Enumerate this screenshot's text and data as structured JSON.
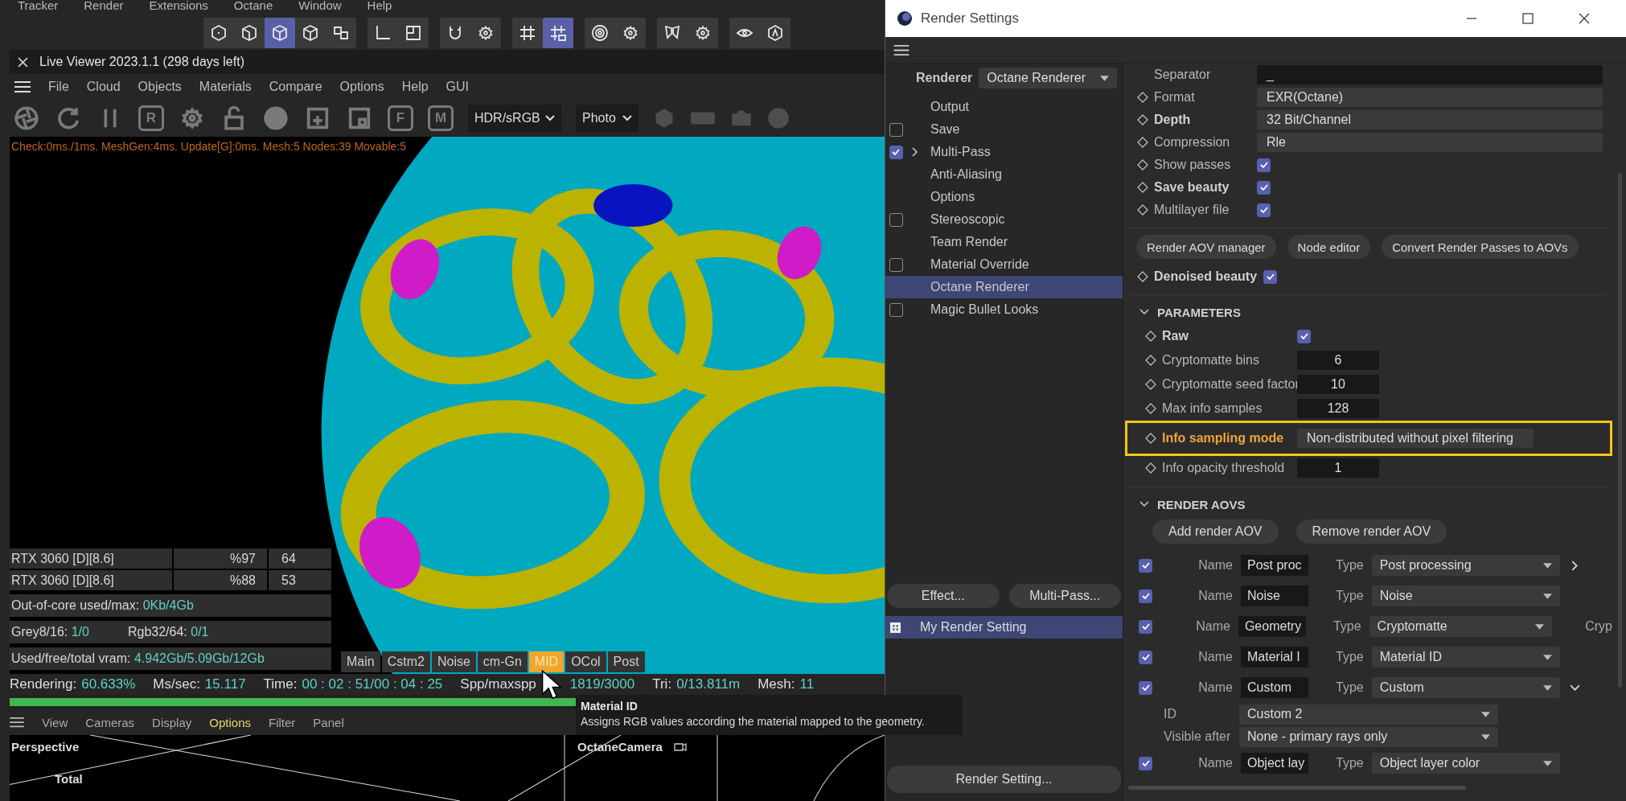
{
  "app_menu": [
    "Tracker",
    "Render",
    "Extensions",
    "Octane",
    "Window",
    "Help"
  ],
  "main_toolbar": [
    [
      {
        "selected": false
      },
      {
        "selected": false
      },
      {
        "selected": true
      },
      {
        "selected": false
      },
      {
        "selected": false
      }
    ],
    [
      {
        "selected": false
      },
      {
        "selected": false
      }
    ],
    [
      {
        "selected": false
      },
      {
        "selected": false
      }
    ],
    [
      {
        "selected": false
      },
      {
        "selected": true
      }
    ],
    [
      {
        "selected": false
      },
      {
        "selected": false
      }
    ],
    [
      {
        "selected": false
      },
      {
        "selected": false
      }
    ],
    [
      {
        "selected": false
      },
      {
        "selected": false
      }
    ]
  ],
  "live_viewer": {
    "title": "Live Viewer 2023.1.1 (298 days left)",
    "menu": [
      "File",
      "Cloud",
      "Objects",
      "Materials",
      "Compare",
      "Options",
      "Help",
      "GUI"
    ],
    "tool_letters": [
      "R",
      "F",
      "M"
    ],
    "display_mode": "HDR/sRGB",
    "camera_mode": "Photo",
    "status_line": "Check:0ms./1ms. MeshGen:4ms. Update[G]:0ms. Mesh:5 Nodes:39 Movable:5",
    "gpus": [
      {
        "name": "RTX 3060 [D][8.6]",
        "usage": "%97",
        "temp": "64"
      },
      {
        "name": "RTX 3060 [D][8.6]",
        "usage": "%88",
        "temp": "53"
      }
    ],
    "memory": [
      [
        {
          "label": "Out-of-core used/max:",
          "value": "0Kb/4Gb"
        }
      ],
      [
        {
          "label": "Grey8/16:",
          "value": "1/0"
        },
        {
          "label": "Rgb32/64:",
          "value": "0/1"
        }
      ],
      [
        {
          "label": "Used/free/total vram:",
          "value": "4.942Gb/5.09Gb/12Gb"
        }
      ]
    ],
    "pass_tabs": [
      {
        "label": "Main",
        "selected": false
      },
      {
        "label": "Cstm2",
        "selected": false
      },
      {
        "label": "Noise",
        "selected": false
      },
      {
        "label": "cm-Gn",
        "selected": false
      },
      {
        "label": "MID",
        "selected": true
      },
      {
        "label": "OCol",
        "selected": false
      },
      {
        "label": "Post",
        "selected": false
      }
    ],
    "render_stats": [
      {
        "label": "Rendering:",
        "value": "60.633%"
      },
      {
        "label": "Ms/sec:",
        "value": "15.117"
      },
      {
        "label": "Time:",
        "value": "00 : 02 : 51/00 : 04 : 25"
      },
      {
        "label": "Spp/maxspp",
        "value": "1819/3000"
      },
      {
        "label": "Tri:",
        "value": "0/13.811m"
      },
      {
        "label": "Mesh:",
        "value": "11"
      }
    ],
    "progress": {
      "level": 0.65
    },
    "tooltip": {
      "title": "Material ID",
      "text": "Assigns RGB values according the material mapped to the geometry."
    }
  },
  "viewport": {
    "menu": [
      {
        "label": "View",
        "selected": false
      },
      {
        "label": "Cameras",
        "selected": false
      },
      {
        "label": "Display",
        "selected": false
      },
      {
        "label": "Options",
        "selected": true
      },
      {
        "label": "Filter",
        "selected": false
      },
      {
        "label": "Panel",
        "selected": false
      }
    ],
    "view_name": "Perspective",
    "overlay_label": "Total",
    "camera_name": "OctaneCamera"
  },
  "render_settings": {
    "title": "Render Settings",
    "renderer_label": "Renderer",
    "renderer": "Octane Renderer",
    "nav": [
      {
        "label": "Output",
        "kind": "plain",
        "expandable": false,
        "selected": false
      },
      {
        "label": "Save",
        "kind": "checkbox",
        "checked": false,
        "expandable": false,
        "selected": false
      },
      {
        "label": "Multi-Pass",
        "kind": "checkbox",
        "checked": true,
        "expandable": true,
        "selected": false
      },
      {
        "label": "Anti-Aliasing",
        "kind": "plain",
        "expandable": false,
        "selected": false
      },
      {
        "label": "Options",
        "kind": "plain",
        "expandable": false,
        "selected": false
      },
      {
        "label": "Stereoscopic",
        "kind": "checkbox",
        "checked": false,
        "expandable": false,
        "selected": false
      },
      {
        "label": "Team Render",
        "kind": "plain",
        "expandable": false,
        "selected": false
      },
      {
        "label": "Material Override",
        "kind": "checkbox",
        "checked": false,
        "expandable": false,
        "selected": false
      },
      {
        "label": "Octane Renderer",
        "kind": "plain",
        "expandable": false,
        "selected": true
      },
      {
        "label": "Magic Bullet Looks",
        "kind": "checkbox",
        "checked": false,
        "expandable": false,
        "selected": false
      }
    ],
    "nav_buttons": [
      "Effect...",
      "Multi-Pass..."
    ],
    "presets": [
      {
        "label": "My Render Setting",
        "selected": true
      }
    ],
    "bottom_button": "Render Setting...",
    "output_props": [
      {
        "label": "Separator",
        "kind": "text",
        "value": "_",
        "bold": false,
        "animatable": false
      },
      {
        "label": "Format",
        "kind": "dropdown",
        "value": "EXR(Octane)",
        "bold": false,
        "animatable": true
      },
      {
        "label": "Depth",
        "kind": "dropdown",
        "value": "32 Bit/Channel",
        "bold": true,
        "animatable": true
      },
      {
        "label": "Compression",
        "kind": "dropdown",
        "value": "Rle",
        "bold": false,
        "animatable": true
      },
      {
        "label": "Show passes",
        "kind": "checkbox",
        "checked": true,
        "bold": false,
        "animatable": true
      },
      {
        "label": "Save beauty",
        "kind": "checkbox",
        "checked": true,
        "bold": true,
        "animatable": true
      },
      {
        "label": "Multilayer file",
        "kind": "checkbox",
        "checked": true,
        "bold": false,
        "animatable": true
      }
    ],
    "action_buttons": [
      "Render AOV manager",
      "Node editor",
      "Convert Render Passes to AOVs"
    ],
    "denoised": {
      "label": "Denoised beauty",
      "checked": true
    },
    "parameters": {
      "title": "PARAMETERS",
      "expanded": true,
      "props": [
        {
          "label": "Raw",
          "kind": "checkbox",
          "checked": true,
          "bold": true,
          "highlighted": false
        },
        {
          "label": "Cryptomatte bins",
          "kind": "number",
          "value": "6",
          "bold": false,
          "highlighted": false
        },
        {
          "label": "Cryptomatte seed factor",
          "kind": "number",
          "value": "10",
          "bold": false,
          "highlighted": false
        },
        {
          "label": "Max info samples",
          "kind": "number",
          "value": "128",
          "bold": false,
          "highlighted": false
        },
        {
          "label": "Info sampling mode",
          "kind": "dropdown",
          "value": "Non-distributed without pixel filtering",
          "bold": true,
          "highlighted": true
        },
        {
          "label": "Info opacity threshold",
          "kind": "number",
          "value": "1",
          "bold": false,
          "highlighted": false
        }
      ]
    },
    "aovs": {
      "title": "RENDER AOVS",
      "expanded": true,
      "buttons": [
        "Add render AOV",
        "Remove render AOV"
      ],
      "rows": [
        {
          "checked": true,
          "name_label": "Name",
          "name": "Post proc",
          "type_label": "Type",
          "type": "Post processing",
          "expanded": false
        },
        {
          "checked": true,
          "name_label": "Name",
          "name": "Noise",
          "type_label": "Type",
          "type": "Noise"
        },
        {
          "checked": true,
          "name_label": "Name",
          "name": "Geometry",
          "type_label": "Type",
          "type": "Cryptomatte",
          "side_text": "Cryp"
        },
        {
          "checked": true,
          "name_label": "Name",
          "name": "Material I",
          "type_label": "Type",
          "type": "Material ID"
        },
        {
          "checked": true,
          "name_label": "Name",
          "name": "Custom",
          "type_label": "Type",
          "type": "Custom",
          "expanded": true,
          "sub": [
            {
              "label": "ID",
              "value": "Custom 2"
            },
            {
              "label": "Visible after",
              "value": "None - primary rays only"
            }
          ]
        },
        {
          "checked": true,
          "name_label": "Name",
          "name": "Object lay",
          "type_label": "Type",
          "type": "Object layer color"
        }
      ]
    }
  }
}
